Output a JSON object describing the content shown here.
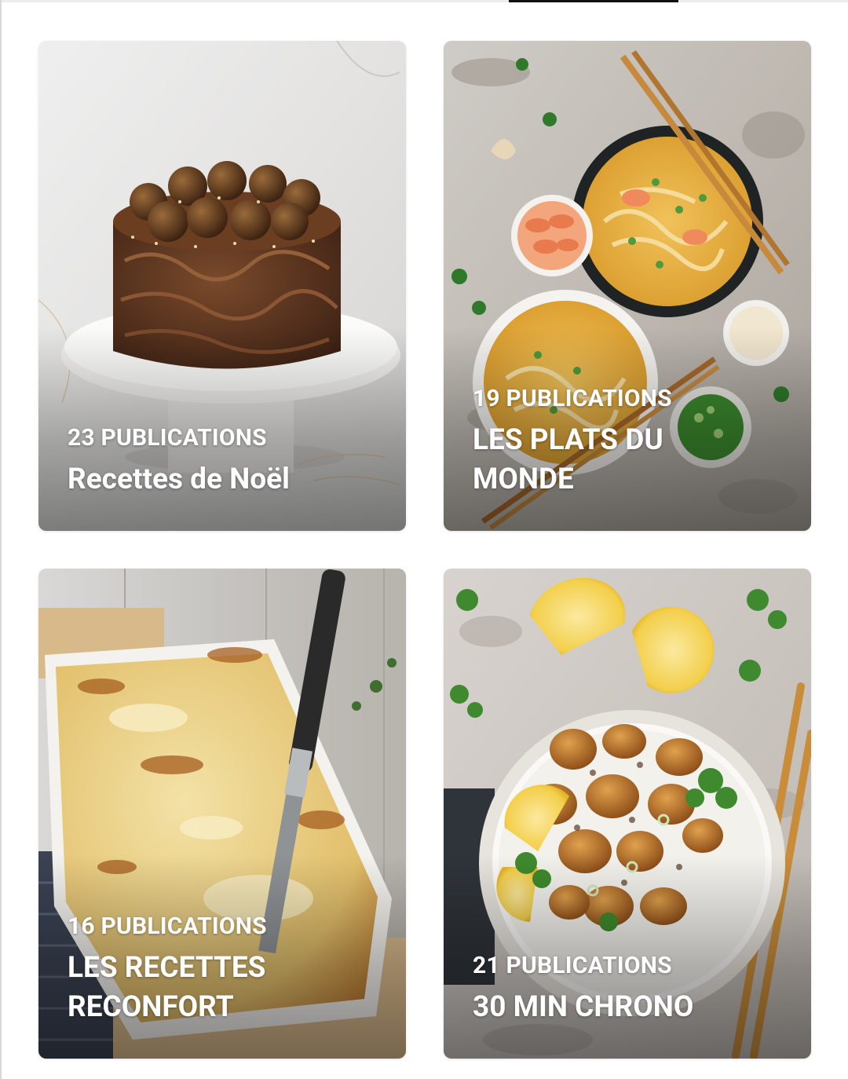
{
  "header": {
    "active_tab_indicator_color": "#111111"
  },
  "cards": [
    {
      "count": "23 PUBLICATIONS",
      "title": "Recettes de Noël",
      "image_subject": "chocolate-cake-photo"
    },
    {
      "count": "19 PUBLICATIONS",
      "title": "LES PLATS DU MONDE",
      "image_subject": "noodle-soup-photo"
    },
    {
      "count": "16 PUBLICATIONS",
      "title": "LES RECETTES RECONFORT",
      "image_subject": "lasagna-photo"
    },
    {
      "count": "21 PUBLICATIONS",
      "title": "30 MIN CHRONO",
      "image_subject": "chicken-rice-bowl-photo"
    }
  ]
}
